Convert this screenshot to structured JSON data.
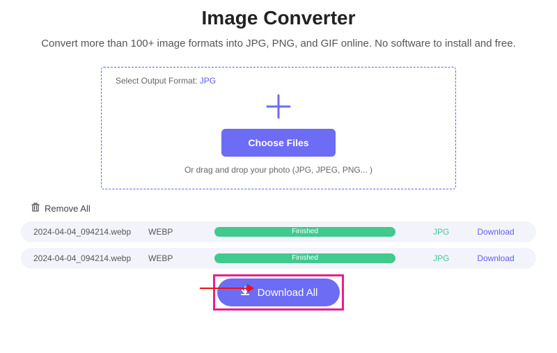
{
  "header": {
    "title": "Image Converter",
    "subtitle": "Convert more than 100+ image formats into JPG, PNG, and GIF online. No software to install and free."
  },
  "dropzone": {
    "format_label": "Select Output Format:",
    "format_value": "JPG",
    "choose_files_label": "Choose Files",
    "drag_hint": "Or drag and drop your photo (JPG, JPEG, PNG... )"
  },
  "actions": {
    "remove_all_label": "Remove All",
    "download_all_label": "Download All"
  },
  "files": [
    {
      "name": "2024-04-04_094214.webp",
      "src_format": "WEBP",
      "status": "Finished",
      "dst_format": "JPG",
      "download_label": "Download"
    },
    {
      "name": "2024-04-04_094214.webp",
      "src_format": "WEBP",
      "status": "Finished",
      "dst_format": "JPG",
      "download_label": "Download"
    }
  ]
}
